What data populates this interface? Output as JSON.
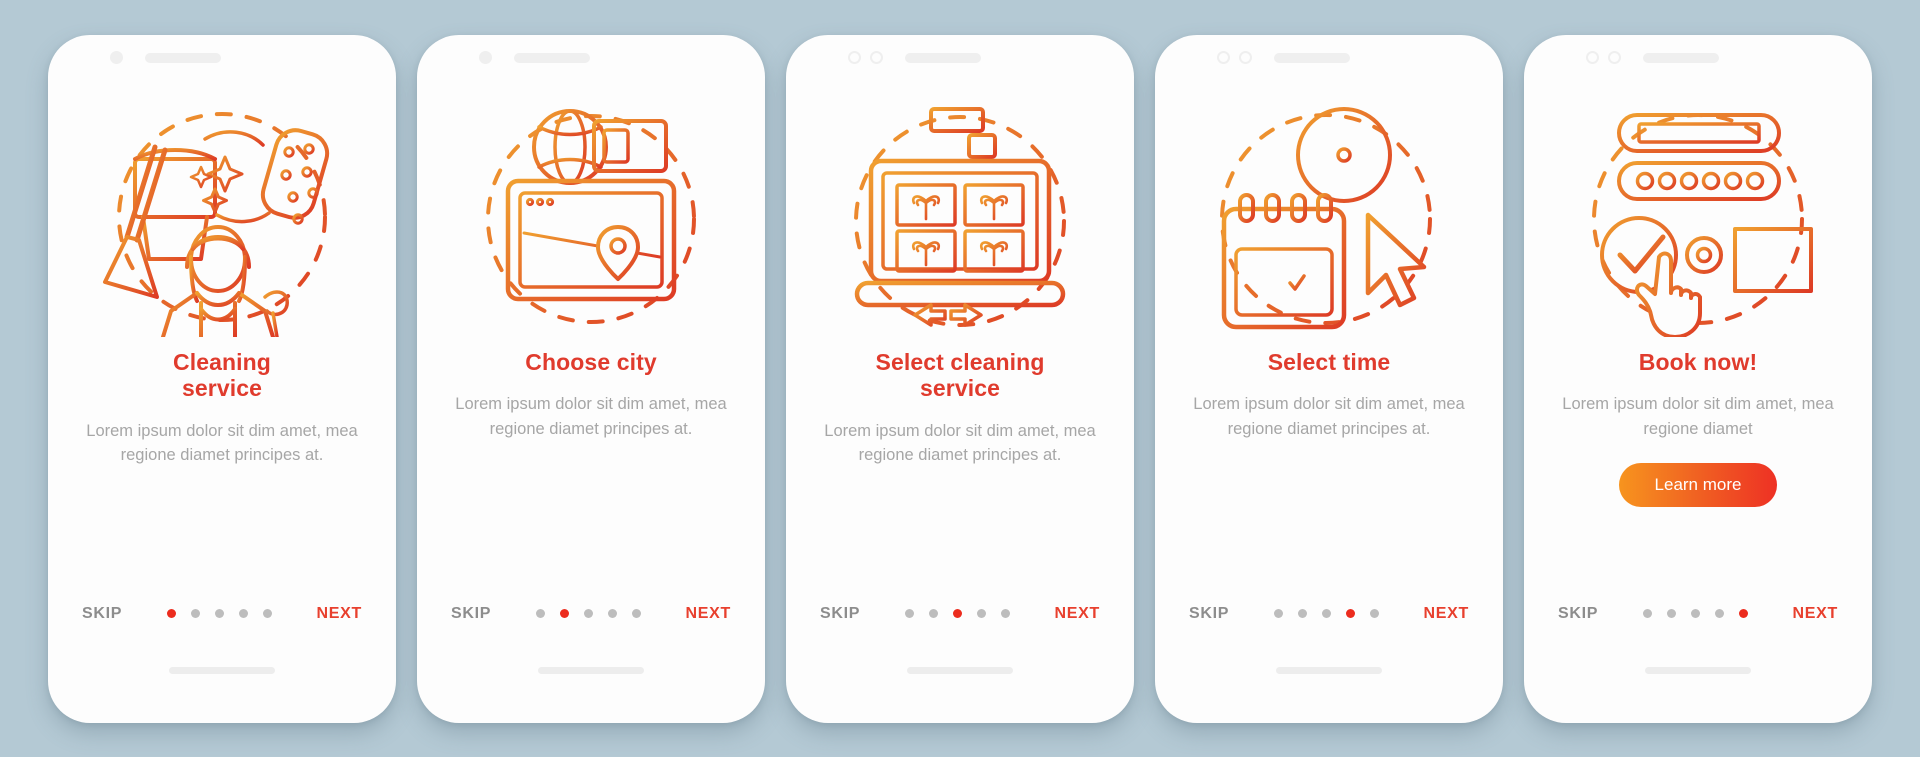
{
  "background_color": "#b4c9d4",
  "accent_color": "#e03b2d",
  "screens": [
    {
      "id": "cleaning-service",
      "illustration": "mop-bucket-sponge-maid-icon",
      "top_dots": 1,
      "title": "Cleaning\nservice",
      "subtitle": "Lorem ipsum dolor sit dim amet, mea regione diamet principes at.",
      "skip_label": "SKIP",
      "next_label": "NEXT",
      "active_dot": 0,
      "dot_count": 5,
      "cta_label": null
    },
    {
      "id": "choose-city",
      "illustration": "globe-map-monitor-icon",
      "top_dots": 1,
      "title": "Choose city",
      "subtitle": "Lorem ipsum dolor sit dim amet, mea regione diamet principes at.",
      "skip_label": "SKIP",
      "next_label": "NEXT",
      "active_dot": 1,
      "dot_count": 5,
      "cta_label": null
    },
    {
      "id": "select-cleaning-service",
      "illustration": "laptop-service-grid-icon",
      "top_dots": 2,
      "title": "Select cleaning\nservice",
      "subtitle": "Lorem ipsum dolor sit dim amet, mea regione diamet principes at.",
      "skip_label": "SKIP",
      "next_label": "NEXT",
      "active_dot": 2,
      "dot_count": 5,
      "cta_label": null
    },
    {
      "id": "select-time",
      "illustration": "calendar-clock-cursor-icon",
      "top_dots": 2,
      "title": "Select time",
      "subtitle": "Lorem ipsum dolor sit dim amet, mea regione diamet principes at.",
      "skip_label": "SKIP",
      "next_label": "NEXT",
      "active_dot": 3,
      "dot_count": 5,
      "cta_label": null
    },
    {
      "id": "book-now",
      "illustration": "form-checkmark-hand-icon",
      "top_dots": 2,
      "title": "Book now!",
      "subtitle": "Lorem ipsum dolor sit dim amet, mea regione diamet",
      "skip_label": "SKIP",
      "next_label": "NEXT",
      "active_dot": 4,
      "dot_count": 5,
      "cta_label": "Learn more"
    }
  ]
}
